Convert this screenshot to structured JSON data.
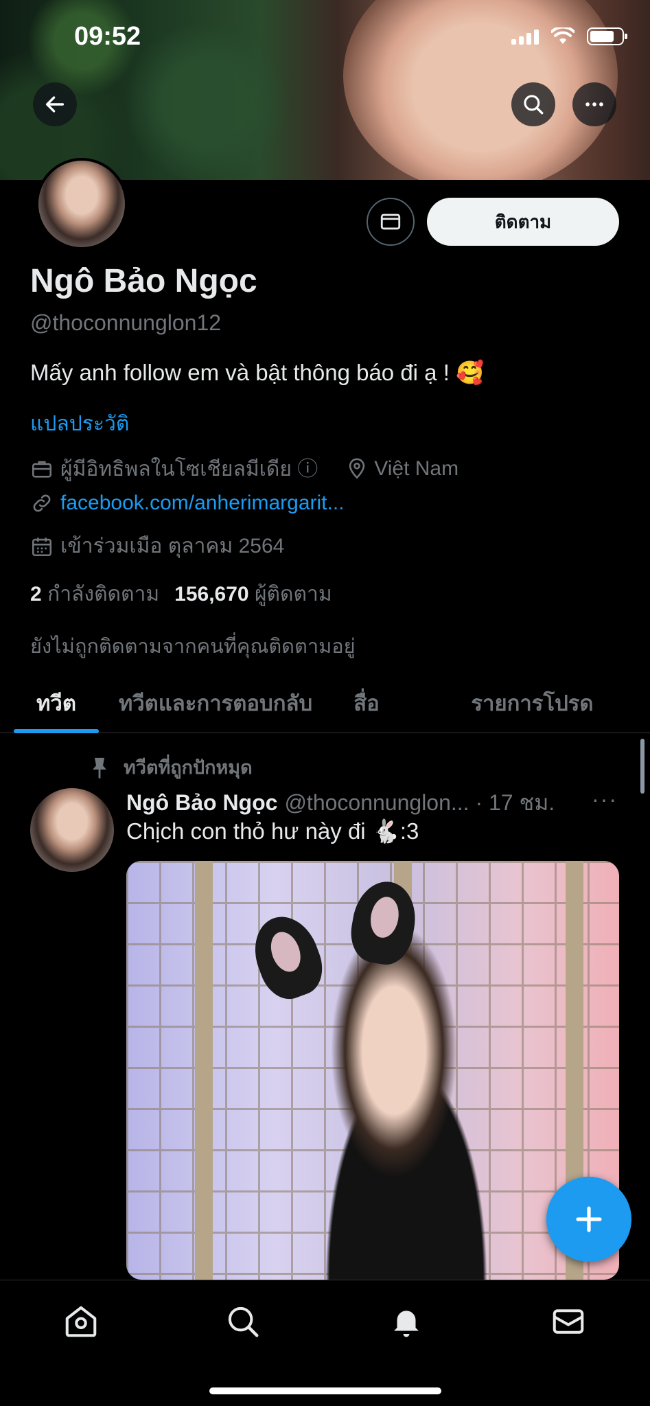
{
  "status_bar": {
    "time": "09:52"
  },
  "profile": {
    "name": "Ngô Bảo Ngọc",
    "handle": "@thoconnunglon12",
    "bio": "Mấy anh follow em và bật thông báo đi ạ ! 🥰",
    "translate_label": "แปลประวัติ",
    "category": "ผู้มีอิทธิพลในโซเชียลมีเดีย ⓘ",
    "location": "Việt Nam",
    "website": "facebook.com/anherimargarit...",
    "joined": "เข้าร่วมเมือ ตุลาคม 2564",
    "following_count": "2",
    "following_label": "กำลังติดตาม",
    "followers_count": "156,670",
    "followers_label": "ผู้ติดตาม",
    "not_followed_note": "ยังไม่ถูกติดตามจากคนที่คุณติดตามอยู่",
    "follow_button": "ติดตาม"
  },
  "tabs": [
    {
      "label": "ทวีต",
      "active": true
    },
    {
      "label": "ทวีตและการตอบกลับ",
      "active": false
    },
    {
      "label": "สื่อ",
      "active": false
    },
    {
      "label": "รายการโปรด",
      "active": false
    }
  ],
  "tweet": {
    "pinned_label": "ทวีตที่ถูกปักหมุด",
    "author_name": "Ngô Bảo Ngọc",
    "author_handle_time": "@thoconnunglon... · 17 ชม.",
    "more": "···",
    "text": "Chịch con thỏ hư này đi 🐇:3"
  },
  "icons": {
    "back": "arrow-left-icon",
    "search": "search-icon",
    "more": "more-icon",
    "message": "envelope-icon",
    "briefcase": "briefcase-icon",
    "location": "location-pin-icon",
    "link": "link-icon",
    "calendar": "calendar-icon",
    "pin": "pin-icon",
    "compose": "plus-icon",
    "nav_home": "home-icon",
    "nav_search": "search-icon",
    "nav_notifications": "bell-icon",
    "nav_messages": "envelope-icon"
  },
  "colors": {
    "accent": "#1d9bf0",
    "background": "#000000",
    "muted": "#71767b"
  }
}
